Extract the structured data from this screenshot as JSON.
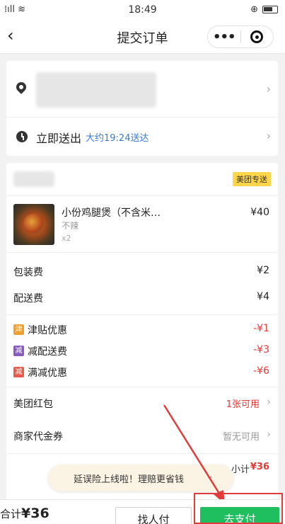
{
  "status_bar": {
    "signal": "⁞ıll ≋",
    "time": "18:49",
    "alarm": "⊕"
  },
  "nav": {
    "back_icon": "chevron-left-icon",
    "title": "提交订单",
    "more": "•••"
  },
  "address": {
    "deliver_label": "立即送出",
    "eta": "大约19:24送达"
  },
  "shop": {
    "badge": "美团专送"
  },
  "item": {
    "name": "小份鸡腿煲（不含米…",
    "spec": "不辣",
    "qty": "x2",
    "price": "¥40"
  },
  "fees": [
    {
      "label": "包装费",
      "value": "¥2"
    },
    {
      "label": "配送费",
      "value": "¥4"
    }
  ],
  "discounts": [
    {
      "icon": "津",
      "label": "津贴优惠",
      "value": "-¥1",
      "color": "#f0a030"
    },
    {
      "icon": "减",
      "label": "减配送费",
      "value": "-¥3",
      "color": "#8a5cc0"
    },
    {
      "icon": "减",
      "label": "满减优惠",
      "value": "-¥6",
      "color": "#e85a4a"
    }
  ],
  "options": [
    {
      "label": "美团红包",
      "value": "1张可用",
      "value_color": "#e53935"
    },
    {
      "label": "商家代金券",
      "value": "暂无可用",
      "value_color": "#999999"
    }
  ],
  "subtotal": {
    "label": "小计",
    "amount": "¥36"
  },
  "toast": {
    "text": "延误险上线啦！理赔更省钱"
  },
  "bottom": {
    "total_label": "合计",
    "total_amount": "¥36",
    "other_pay": "找人付",
    "pay": "去支付"
  }
}
